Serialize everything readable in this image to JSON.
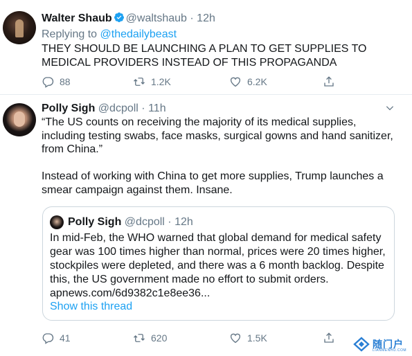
{
  "tweet1": {
    "name": "Walter Shaub",
    "handle": "@waltshaub",
    "separator": "·",
    "time": "12h",
    "replying_prefix": "Replying to ",
    "replying_handle": "@thedailybeast",
    "text": "THEY SHOULD BE LAUNCHING A PLAN TO GET SUPPLIES TO MEDICAL PROVIDERS INSTEAD OF THIS PROPAGANDA",
    "replies": "88",
    "retweets": "1.2K",
    "likes": "6.2K"
  },
  "tweet2": {
    "name": "Polly Sigh",
    "handle": "@dcpoll",
    "separator": "·",
    "time": "11h",
    "text": "“The US counts on receiving the majority of its medical supplies, including testing swabs, face masks, surgical gowns and hand sanitizer, from China.”\n\nInstead of working with China to get more supplies, Trump launches a smear campaign against them. Insane.",
    "quote": {
      "name": "Polly Sigh",
      "handle": "@dcpoll",
      "separator": "·",
      "time": "12h",
      "text": "In mid-Feb, the WHO warned that global demand for medical safety gear was 100 times higher than normal, prices were 20 times higher, stockpiles were depleted, and there was a 6 month backlog. Despite this, the US government made no effort to submit orders. apnews.com/6d9382c1e8ee36...",
      "show_thread": "Show this thread"
    },
    "replies": "41",
    "retweets": "620",
    "likes": "1.5K"
  },
  "watermark": {
    "text": "随门户",
    "sub": "LIANMENHU.COM"
  },
  "colors": {
    "link_blue": "#1da1f2",
    "secondary_gray": "#657786",
    "text_dark": "#14171a",
    "border": "#ccd6dd"
  },
  "icons": [
    "verified-badge-icon",
    "chevron-down-icon",
    "reply-icon",
    "retweet-icon",
    "like-icon",
    "share-icon"
  ]
}
